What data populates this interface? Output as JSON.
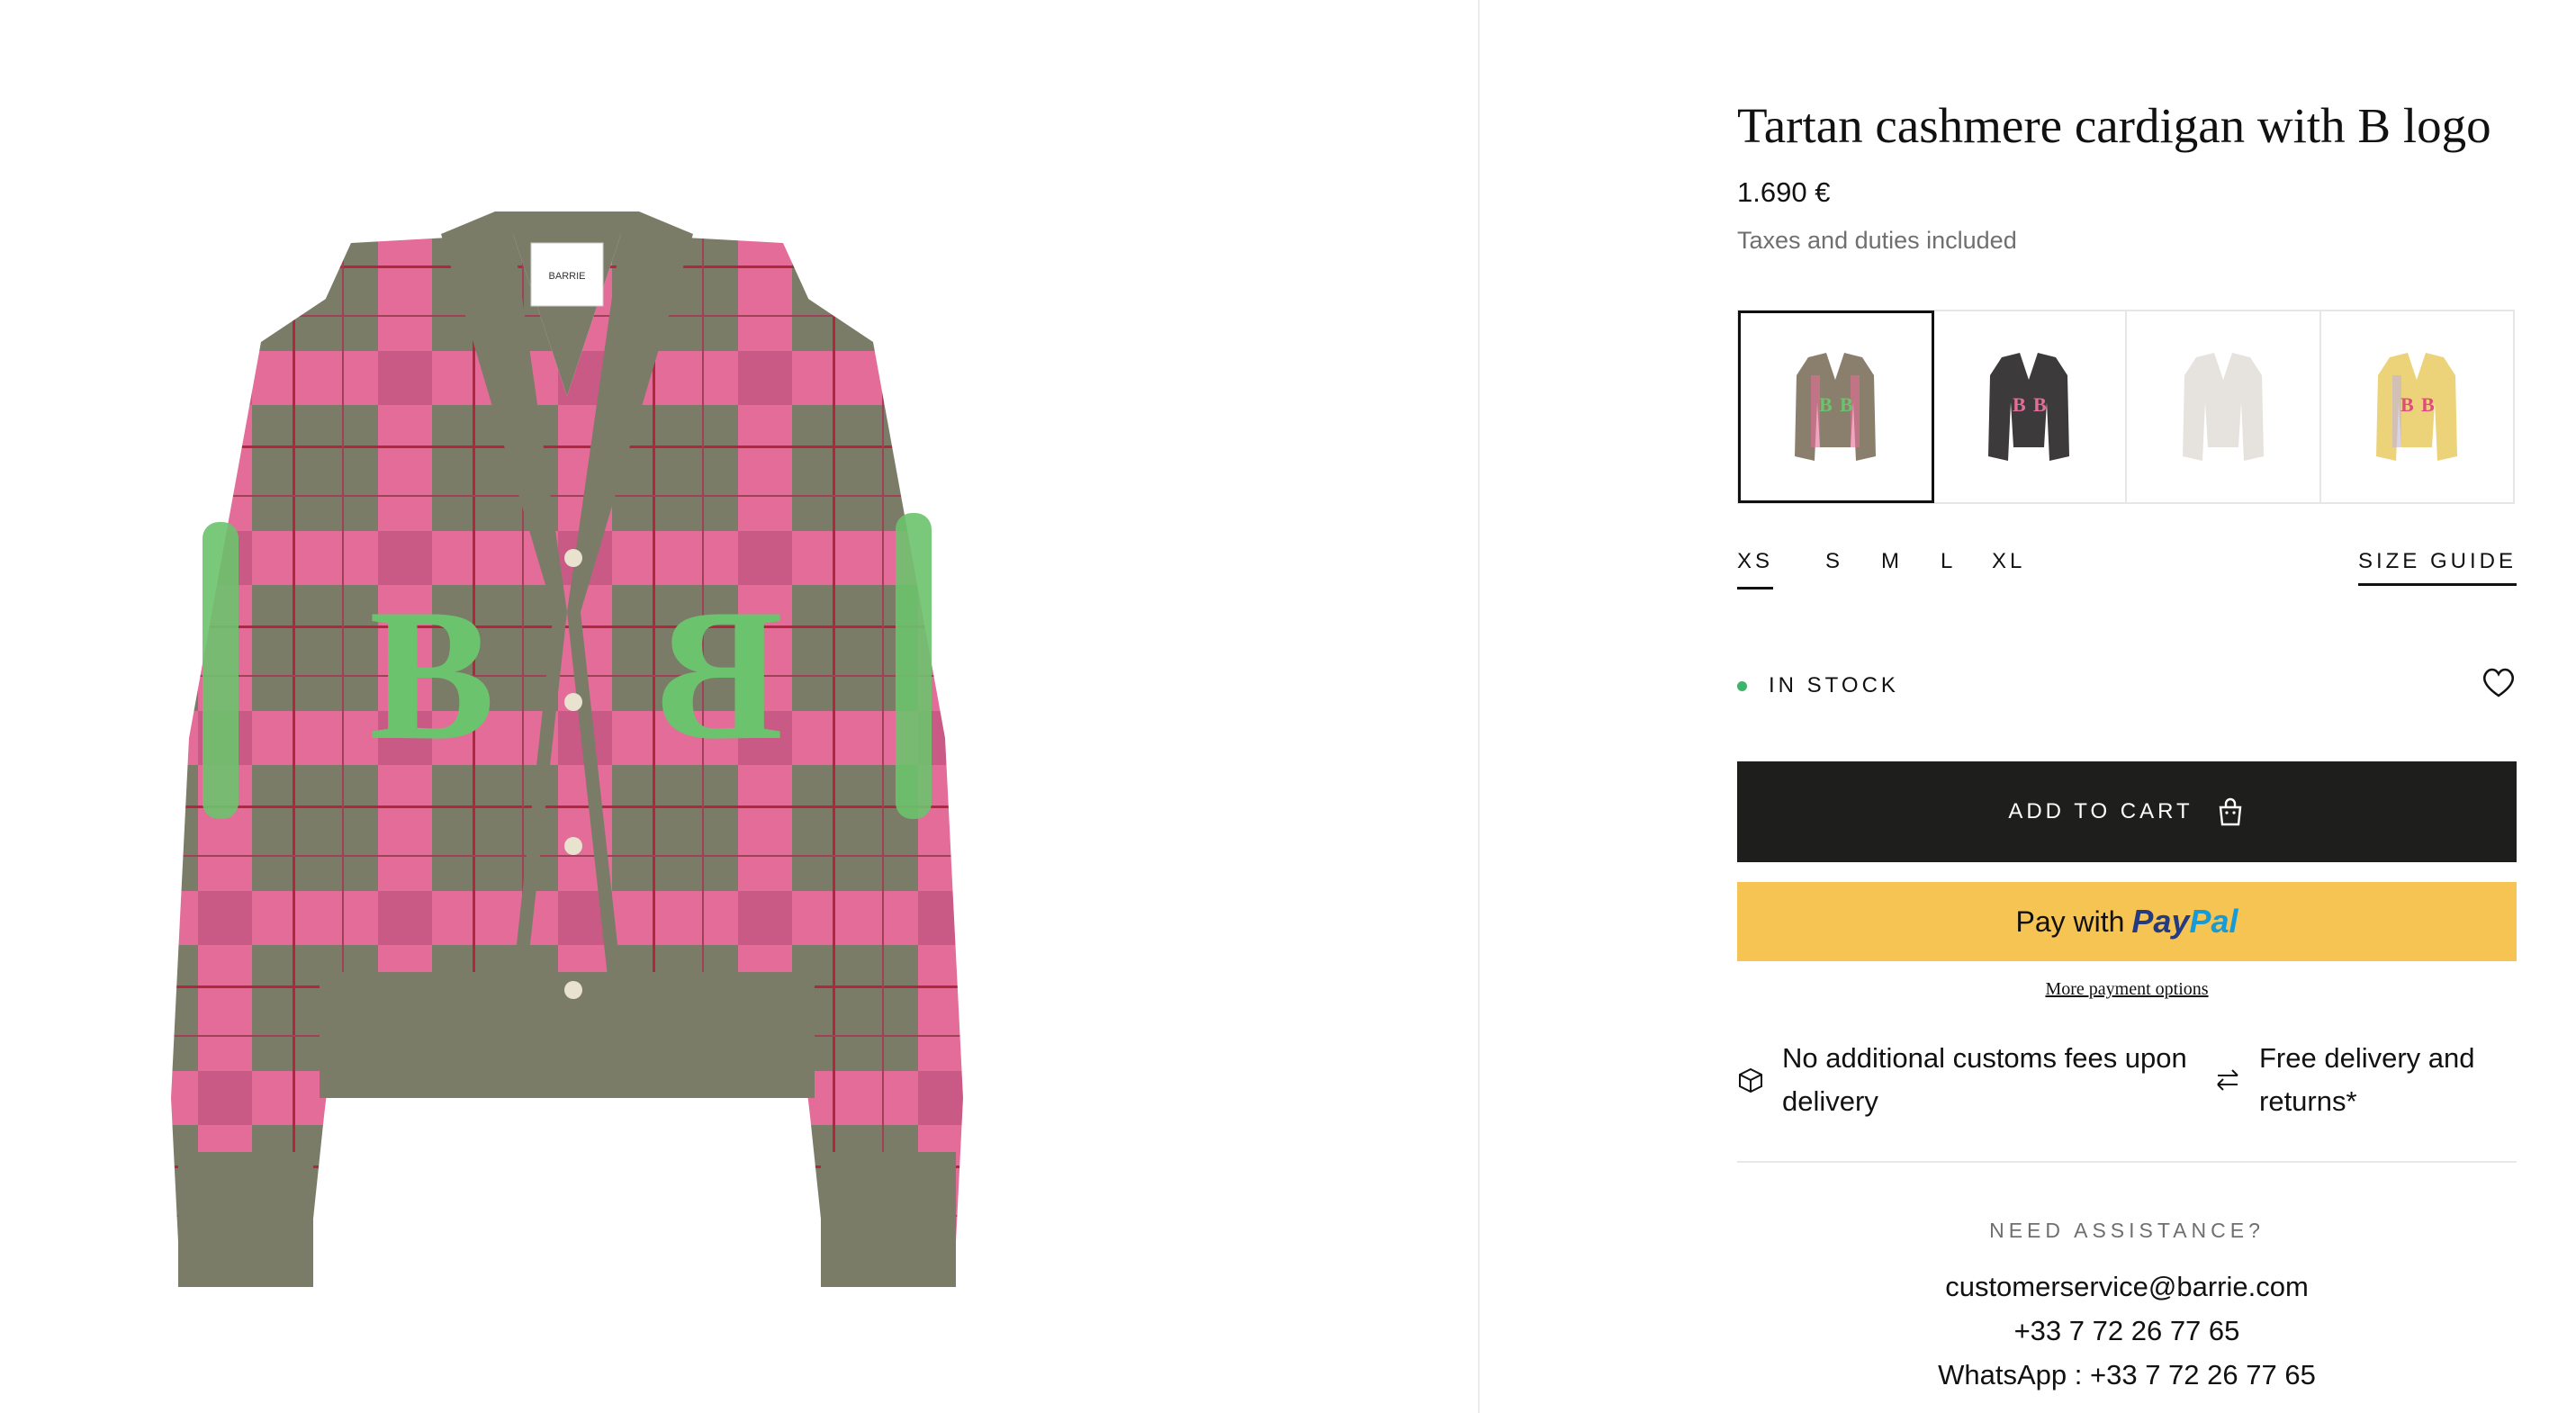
{
  "product": {
    "title": "Tartan cashmere cardigan with B logo",
    "price": "1.690 €",
    "tax_note": "Taxes and duties included"
  },
  "swatches": [
    {
      "name": "green-pink",
      "selected": true
    },
    {
      "name": "charcoal",
      "selected": false
    },
    {
      "name": "white",
      "selected": false
    },
    {
      "name": "yellow",
      "selected": false
    }
  ],
  "sizes": {
    "options": [
      "XS",
      "S",
      "M",
      "L",
      "XL"
    ],
    "selected": "XS",
    "guide_label": "SIZE GUIDE"
  },
  "stock": {
    "label": "IN STOCK",
    "color": "#3fb36a"
  },
  "actions": {
    "add_to_cart": "ADD TO CART",
    "paypal_prefix": "Pay with",
    "paypal_brand_1": "Pay",
    "paypal_brand_2": "Pal",
    "more_payment": "More payment options"
  },
  "features": [
    {
      "icon": "box-icon",
      "text_line1": "No additional customs fees upon",
      "text_line2": "delivery"
    },
    {
      "icon": "exchange-icon",
      "text_line1": "Free delivery and",
      "text_line2": "returns*"
    }
  ],
  "assistance": {
    "title": "NEED ASSISTANCE?",
    "email": "customerservice@barrie.com",
    "phone": "+33 7 72 26 77 65",
    "whatsapp": "WhatsApp : +33 7 72 26 77 65"
  },
  "label_brand": "BARRIE",
  "colors": {
    "cart_button": "#1e1e1c",
    "paypal_button": "#f6c452",
    "knit_grey": "#7b7c68",
    "knit_pink": "#e46c98",
    "logo_green": "#6cc36d"
  }
}
